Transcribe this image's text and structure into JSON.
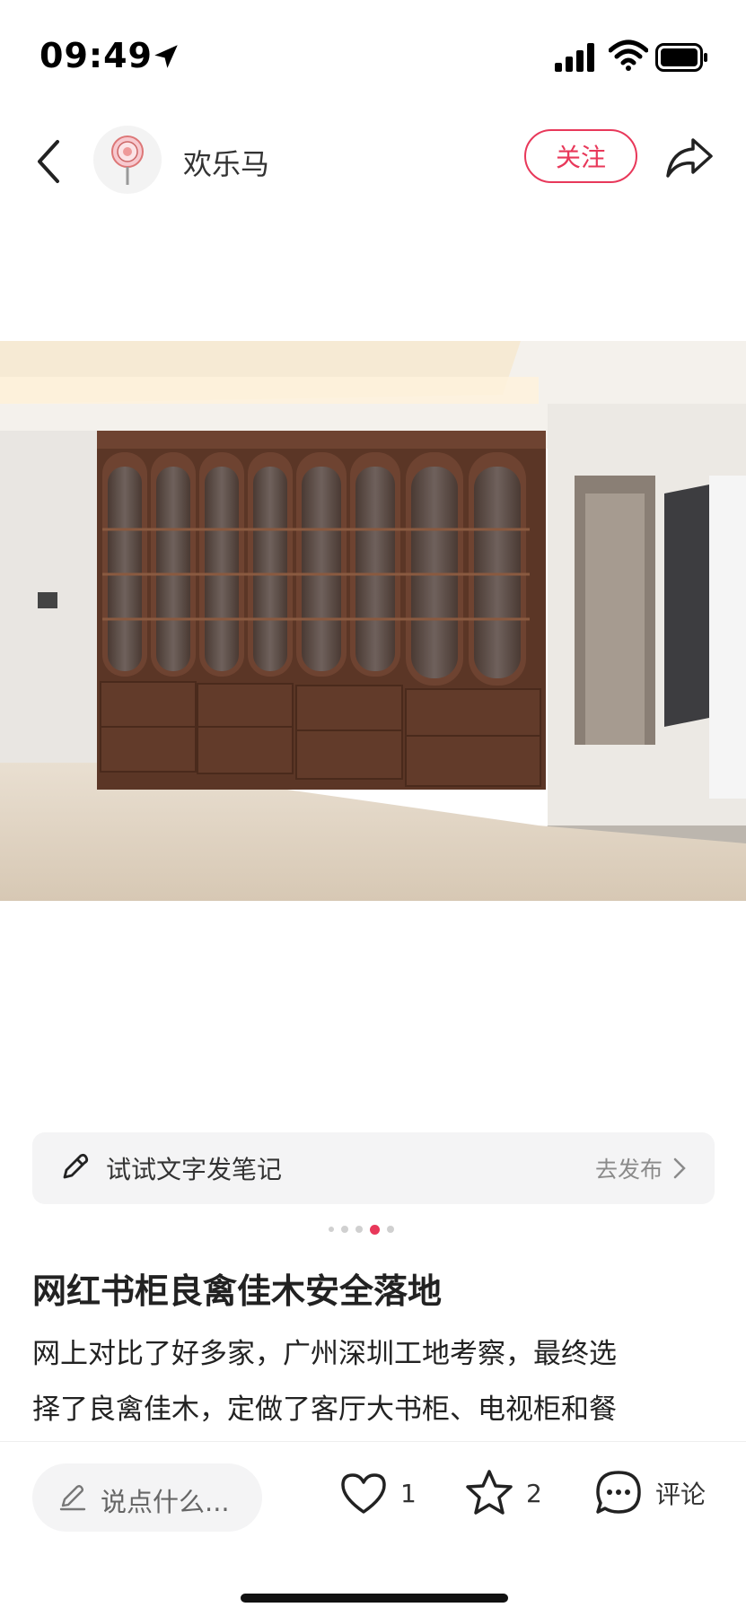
{
  "status_bar": {
    "time": "09:49"
  },
  "header": {
    "author": "欢乐马",
    "follow_label": "关注"
  },
  "prompt": {
    "text": "试试文字发笔记",
    "action": "去发布"
  },
  "carousel": {
    "count": 5,
    "active_index": 3
  },
  "post": {
    "title": "网红书柜良禽佳木安全落地",
    "body_line1": "网上对比了好多家，广州深圳工地考察，最终选",
    "body_line2": "择了良禽佳木，定做了客厅大书柜、电视柜和餐"
  },
  "bottom_bar": {
    "comment_placeholder": "说点什么...",
    "like_count": "1",
    "star_count": "2",
    "comment_label": "评论"
  },
  "colors": {
    "accent": "#e8385a",
    "wood": "#5b3626"
  }
}
